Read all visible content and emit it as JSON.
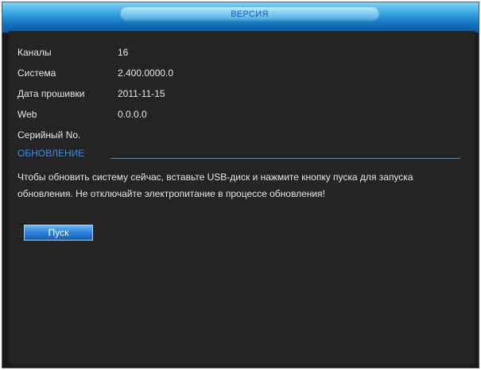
{
  "window": {
    "title": "ВЕРСИЯ"
  },
  "info": {
    "rows": [
      {
        "label": "Каналы",
        "value": "16"
      },
      {
        "label": "Система",
        "value": "2.400.0000.0"
      },
      {
        "label": "Дата прошивки",
        "value": "2011-11-15"
      },
      {
        "label": "Web",
        "value": "0.0.0.0"
      },
      {
        "label": "Серийный No.",
        "value": ""
      }
    ]
  },
  "update": {
    "section_title": "ОБНОВЛЕНИЕ",
    "message": "Чтобы обновить систему сейчас, вставьте USB-диск и нажмите кнопку пуска для запуска обновления. Не отключайте электропитание в процессе обновления!",
    "start_label": "Пуск"
  },
  "colors": {
    "title_bar": "#1574bf",
    "background": "#242424",
    "text": "#e6e6e6",
    "section_accent": "#3c8de8",
    "title_text": "#1f4ec9"
  }
}
